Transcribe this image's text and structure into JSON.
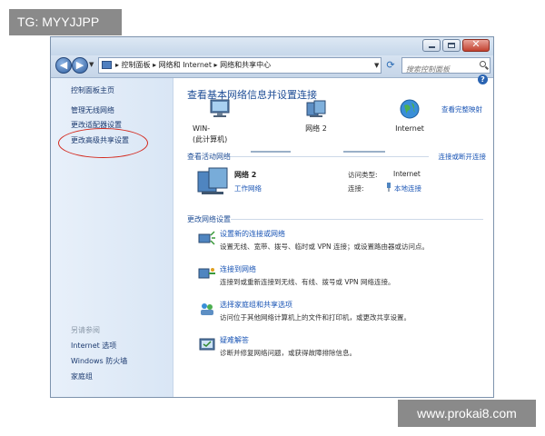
{
  "tag_label": "TG: MYYJJPP",
  "watermark": "www.prokai8.com",
  "address_bar": {
    "breadcrumb": "▸ 控制面板 ▸ 网络和 Internet ▸ 网络和共享中心",
    "search_placeholder": "搜索控制面板"
  },
  "sidebar": {
    "home": "控制面板主页",
    "items": [
      "管理无线网络",
      "更改适配器设置",
      "更改高级共享设置"
    ],
    "see_also_heading": "另请参阅",
    "see_also": [
      "Internet 选项",
      "Windows 防火墙",
      "家庭组"
    ]
  },
  "main": {
    "title": "查看基本网络信息并设置连接",
    "full_map_link": "查看完整映射",
    "map": {
      "computer": "WIN-\n(此计算机)",
      "network": "网络 2",
      "internet": "Internet"
    },
    "active_networks_label": "查看活动网络",
    "connect_disconnect_link": "连接或断开连接",
    "active_network": {
      "name": "网络 2",
      "type": "工作网络",
      "access_type_label": "访问类型:",
      "access_type_value": "Internet",
      "connections_label": "连接:",
      "connections_value": "本地连接"
    },
    "change_settings_label": "更改网络设置",
    "tasks": [
      {
        "title": "设置新的连接或网络",
        "desc": "设置无线、宽带、拨号、临时或 VPN 连接；或设置路由器或访问点。"
      },
      {
        "title": "连接到网络",
        "desc": "连接到或重新连接到无线、有线、拨号或 VPN 网络连接。"
      },
      {
        "title": "选择家庭组和共享选项",
        "desc": "访问位于其他网络计算机上的文件和打印机，或更改共享设置。"
      },
      {
        "title": "疑难解答",
        "desc": "诊断并修复网络问题，或获得故障排除信息。"
      }
    ]
  },
  "icons": {
    "help": "help-icon",
    "back": "back-arrow-icon",
    "forward": "forward-arrow-icon",
    "search": "search-icon",
    "refresh": "refresh-icon"
  },
  "colors": {
    "accent": "#1a55b5",
    "title": "#1e4d96",
    "highlight_oval": "#d42a1f"
  }
}
